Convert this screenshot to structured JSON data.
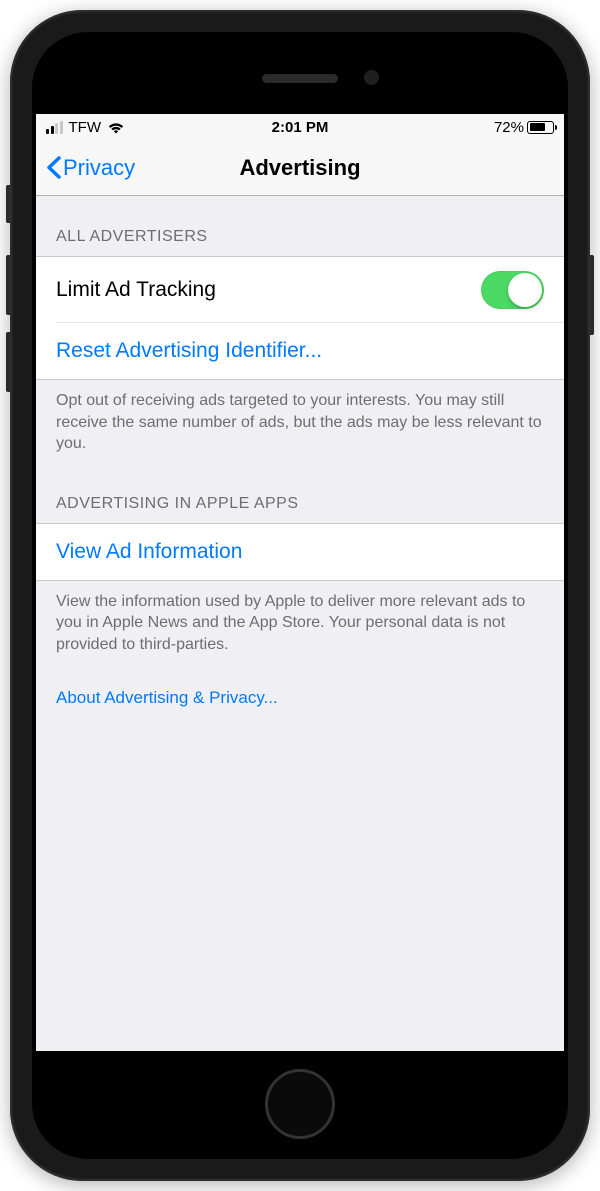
{
  "statusBar": {
    "carrier": "TFW",
    "time": "2:01 PM",
    "batteryPercent": "72%"
  },
  "nav": {
    "back": "Privacy",
    "title": "Advertising"
  },
  "sections": {
    "allAdvertisers": {
      "header": "ALL ADVERTISERS",
      "limitAdTracking": "Limit Ad Tracking",
      "resetIdentifier": "Reset Advertising Identifier...",
      "footer": "Opt out of receiving ads targeted to your interests. You may still receive the same number of ads, but the ads may be less relevant to you."
    },
    "appleApps": {
      "header": "ADVERTISING IN APPLE APPS",
      "viewAdInfo": "View Ad Information",
      "footer": "View the information used by Apple to deliver more relevant ads to you in Apple News and the App Store. Your personal data is not provided to third-parties."
    }
  },
  "aboutLink": "About Advertising & Privacy..."
}
